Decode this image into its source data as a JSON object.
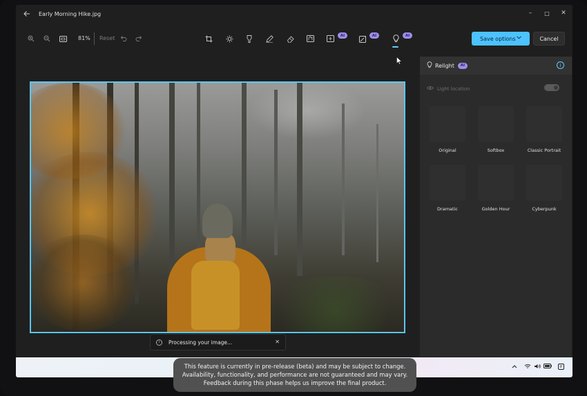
{
  "window": {
    "title": "Early Morning Hike.jpg",
    "back_icon": "arrow-left-icon",
    "controls": {
      "minimize": "–",
      "maximize": "□",
      "close": "✕"
    }
  },
  "toolbar": {
    "zoom_in_icon": "zoom-in-icon",
    "zoom_out_icon": "zoom-out-icon",
    "fit_icon": "fit-to-window-icon",
    "zoom_level": "81%",
    "reset_label": "Reset",
    "undo_icon": "undo-icon",
    "redo_icon": "redo-icon",
    "tools": [
      {
        "name": "crop",
        "icon": "crop-icon"
      },
      {
        "name": "adjust",
        "icon": "brightness-icon"
      },
      {
        "name": "filter",
        "icon": "filter-icon"
      },
      {
        "name": "markup",
        "icon": "pen-icon"
      },
      {
        "name": "erase",
        "icon": "eraser-icon"
      },
      {
        "name": "background",
        "icon": "background-icon"
      },
      {
        "name": "generative-erase",
        "icon": "generative-erase-icon",
        "badge": "AI"
      },
      {
        "name": "generative-fill",
        "icon": "generative-fill-icon",
        "badge": "AI"
      },
      {
        "name": "relight",
        "icon": "lightbulb-icon",
        "badge": "AI",
        "active": true
      }
    ],
    "save_label": "Save options",
    "cancel_label": "Cancel"
  },
  "panel": {
    "title": "Relight",
    "badge": "AI",
    "light_location_label": "Light location",
    "light_location_enabled": false,
    "presets": [
      {
        "label": "Original"
      },
      {
        "label": "Softbox"
      },
      {
        "label": "Classic Portrait"
      },
      {
        "label": "Dramatic"
      },
      {
        "label": "Golden Hour"
      },
      {
        "label": "Cyberpunk"
      }
    ]
  },
  "toast": {
    "message": "Processing your image..."
  },
  "disclaimer": {
    "line1": "This feature is currently in pre-release (beta) and may be subject to change.",
    "line2": "Availability, functionality, and performance are not guaranteed and may vary.",
    "line3": "Feedback during this phase helps us improve the final product."
  },
  "colors": {
    "accent": "#4cc2ff",
    "ai_badge": "#9c8ee8",
    "panel_bg": "#2b2b2b",
    "app_bg": "#1f1f1f"
  }
}
